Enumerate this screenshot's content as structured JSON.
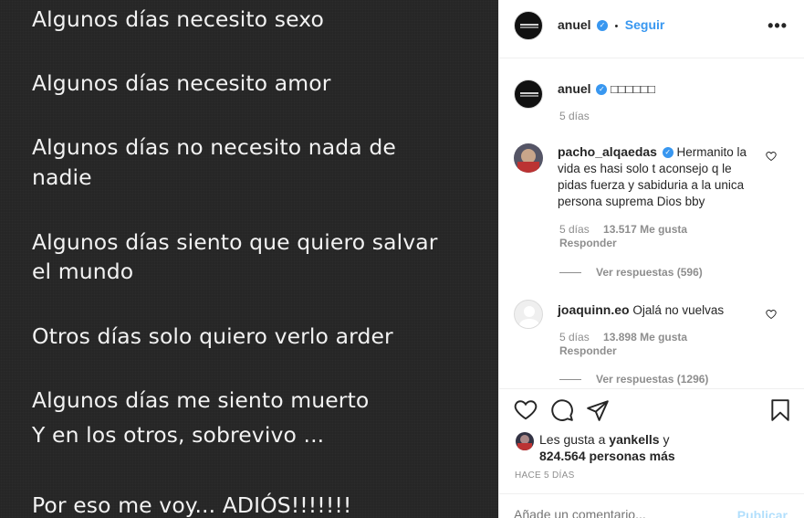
{
  "post_image": {
    "lines": [
      "Algunos días necesito sexo",
      "Algunos días necesito amor",
      "Algunos días no necesito nada de",
      "nadie",
      "Algunos días siento que quiero salvar",
      "el mundo",
      "Otros días solo quiero verlo arder",
      "Algunos días me siento muerto",
      "Y en los otros, sobrevivo ...",
      "Por eso me voy... ADIÓS!!!!!!!"
    ]
  },
  "header": {
    "username": "anuel",
    "separator": "•",
    "follow_label": "Seguir",
    "more_label": "•••"
  },
  "caption": {
    "username": "anuel",
    "text": "□□□□□□",
    "time": "5 días"
  },
  "comments": [
    {
      "username": "pacho_alqaedas",
      "text_lines": [
        "Hermanito la",
        "vida es hasi solo t aconsejo q le",
        "pidas fuerza y sabiduria a la unica",
        "persona suprema Dios bby"
      ],
      "time": "5 días",
      "likes": "13.517 Me gusta",
      "reply": "Responder",
      "view_replies": "Ver respuestas (596)"
    },
    {
      "username": "joaquinn.eo",
      "text": "Ojalá no vuelvas",
      "time": "5 días",
      "likes": "13.898 Me gusta",
      "reply": "Responder",
      "view_replies": "Ver respuestas (1296)"
    }
  ],
  "actions": {
    "likes_prefix": "Les gusta a",
    "likes_user": "yankells",
    "likes_connector": "y",
    "likes_count": "824.564 personas más",
    "posted_ago": "HACE 5 DÍAS"
  },
  "add_comment": {
    "placeholder": "Añade un comentario...",
    "publish_label": "Publicar"
  },
  "colors": {
    "accent": "#3897f0",
    "muted": "#8e8e8e",
    "text": "#262626",
    "image_bg": "#262626"
  }
}
